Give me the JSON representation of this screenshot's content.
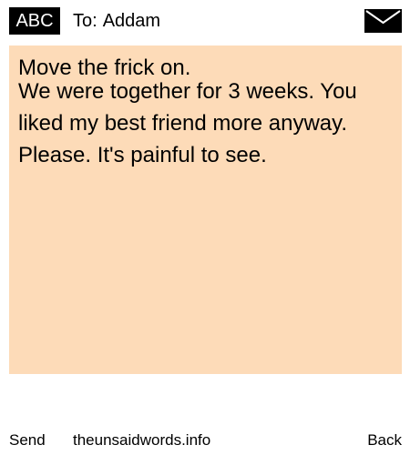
{
  "header": {
    "mode_label": "ABC",
    "to_prefix": "To:",
    "recipient": "Addam",
    "envelope_icon": "envelope-icon"
  },
  "message": {
    "line1": "Move the frick on.",
    "line2": "We were together for 3 weeks. You liked my best friend more anyway. Please. It's painful to see."
  },
  "footer": {
    "send_label": "Send",
    "site_label": "theunsaidwords.info",
    "back_label": "Back"
  },
  "colors": {
    "message_background": "#fddbb8",
    "badge_background": "#000000",
    "text": "#000000"
  }
}
